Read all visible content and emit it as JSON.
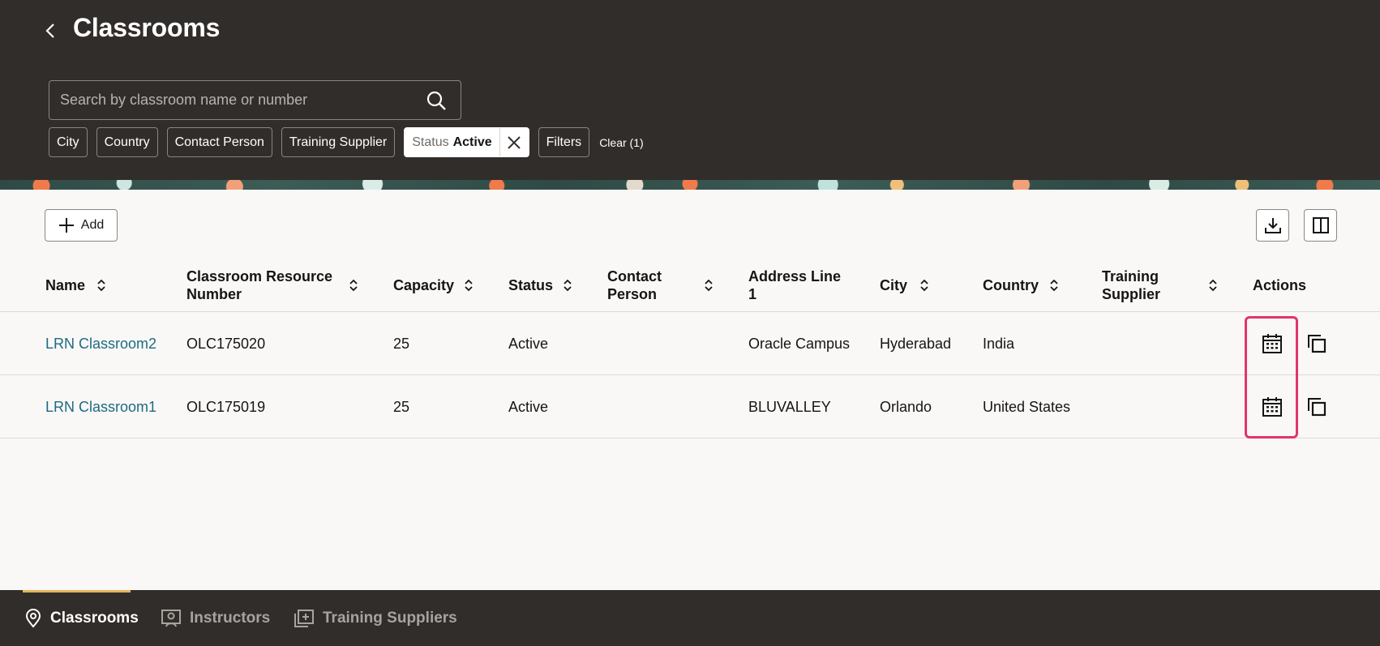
{
  "header": {
    "title": "Classrooms",
    "search": {
      "placeholder": "Search by classroom name or number",
      "value": ""
    },
    "chips": [
      "City",
      "Country",
      "Contact Person",
      "Training Supplier"
    ],
    "active_filter": {
      "key": "Status",
      "value": "Active"
    },
    "filters_label": "Filters",
    "clear_label": "Clear (1)"
  },
  "toolbar": {
    "add_label": "Add"
  },
  "table": {
    "columns": [
      {
        "line1": "Name",
        "line2": ""
      },
      {
        "line1": "Classroom Resource",
        "line2": "Number"
      },
      {
        "line1": "Capacity",
        "line2": ""
      },
      {
        "line1": "Status",
        "line2": ""
      },
      {
        "line1": "Contact",
        "line2": "Person"
      },
      {
        "line1": "Address Line",
        "line2": "1"
      },
      {
        "line1": "City",
        "line2": ""
      },
      {
        "line1": "Country",
        "line2": ""
      },
      {
        "line1": "Training",
        "line2": "Supplier"
      },
      {
        "line1": "Actions",
        "line2": ""
      }
    ],
    "rows": [
      {
        "name": "LRN Classroom2",
        "number": "OLC175020",
        "capacity": "25",
        "status": "Active",
        "contact": "",
        "address": "Oracle Campus",
        "city": "Hyderabad",
        "country": "India",
        "supplier": ""
      },
      {
        "name": "LRN Classroom1",
        "number": "OLC175019",
        "capacity": "25",
        "status": "Active",
        "contact": "",
        "address": "BLUVALLEY",
        "city": "Orlando",
        "country": "United States",
        "supplier": ""
      }
    ]
  },
  "bottom_nav": {
    "items": [
      {
        "label": "Classrooms",
        "icon": "location-pin-icon",
        "active": true
      },
      {
        "label": "Instructors",
        "icon": "instructor-icon",
        "active": false
      },
      {
        "label": "Training Suppliers",
        "icon": "supplier-icon",
        "active": false
      }
    ]
  },
  "colors": {
    "header_bg": "#312d2a",
    "link": "#1c6b84",
    "highlight": "#e2346a",
    "nav_indicator": "#e3b55b"
  }
}
